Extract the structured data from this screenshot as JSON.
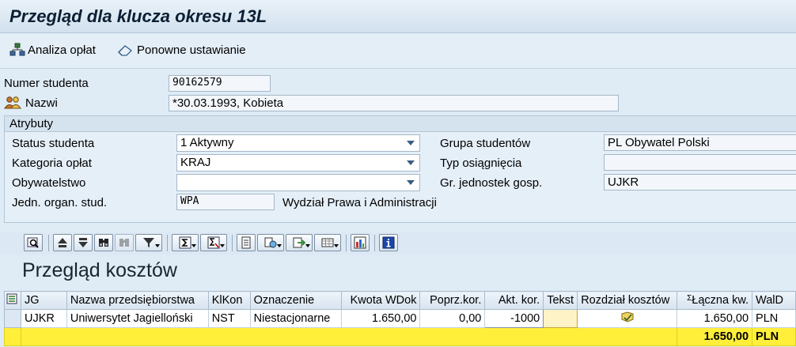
{
  "window": {
    "title": "Przegląd dla klucza okresu 13L"
  },
  "toolbar": {
    "analiza_label": "Analiza opłat",
    "reset_label": "Ponowne ustawianie"
  },
  "header": {
    "numer_label": "Numer studenta",
    "numer_value": "90162579",
    "nazwi_label": "Nazwi",
    "nazwi_value": "        *30.03.1993, Kobieta"
  },
  "attributes": {
    "group_title": "Atrybuty",
    "status_label": "Status studenta",
    "status_value": "1 Aktywny",
    "kategoria_label": "Kategoria opłat",
    "kategoria_value": "KRAJ",
    "obyw_label": "Obywatelstwo",
    "obyw_value": "",
    "jedn_label": "Jedn. organ. stud.",
    "jedn_code": "WPA",
    "jedn_text": "Wydział Prawa i Administracji",
    "grupa_label": "Grupa studentów",
    "grupa_value": "PL Obywatel Polski",
    "typ_label": "Typ osiągnięcia",
    "typ_value": "",
    "grjedn_label": "Gr. jednostek gosp.",
    "grjedn_value": "UJKR"
  },
  "section": {
    "title": "Przegląd kosztów"
  },
  "table": {
    "columns": [
      "JG",
      "Nazwa przedsiębiorstwa",
      "KlKon",
      "Oznaczenie",
      "Kwota WDok",
      "Poprz.kor.",
      "Akt. kor.",
      "Tekst",
      "Rozdział kosztów",
      "Łączna kw.",
      "WalD"
    ],
    "sum_symbol": "Σ",
    "row": {
      "jg": "UJKR",
      "nazwa": "Uniwersytet Jagielloński",
      "klkon": "NST",
      "oznaczenie": "Niestacjonarne",
      "kwota": "1.650,00",
      "poprz": "0,00",
      "akt": "-1000",
      "tekst": "",
      "laczna": "1.650,00",
      "wald": "PLN"
    },
    "total": {
      "laczna": "1.650,00",
      "wald": "PLN"
    }
  },
  "icons": {
    "analiza": "hierarchy-icon",
    "reset": "eraser-icon",
    "nazwi": "persons-icon",
    "rozdzial": "distribution-icon"
  },
  "colors": {
    "sum_row": "#ffef3a",
    "background": "#dfebf5"
  }
}
